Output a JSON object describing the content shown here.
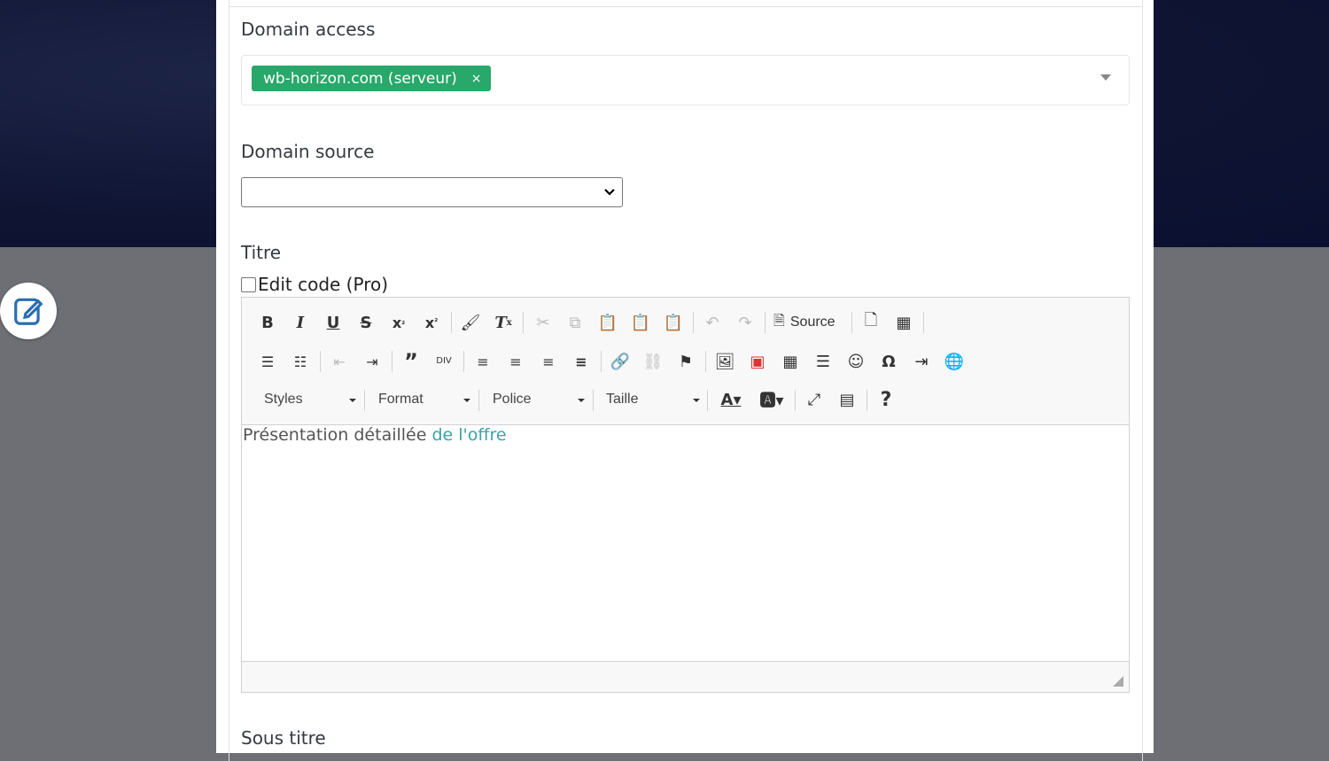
{
  "form": {
    "domain_access": {
      "label": "Domain access",
      "selected_tag": "wb-horizon.com (serveur)",
      "tag_remove": "×"
    },
    "domain_source": {
      "label": "Domain source",
      "value": ""
    },
    "titre": {
      "label": "Titre",
      "edit_code_label": "Edit code (Pro)",
      "edit_code_checked": false
    },
    "editor": {
      "toolbar_row1": [
        "bold",
        "italic",
        "underline",
        "strikethrough",
        "subscript",
        "superscript",
        "copy-formatting",
        "remove-format",
        "cut",
        "copy",
        "paste",
        "paste-text",
        "paste-word",
        "undo",
        "redo",
        "source",
        "preview",
        "templates"
      ],
      "source_label": "Source",
      "combos": {
        "styles": "Styles",
        "format": "Format",
        "police": "Police",
        "taille": "Taille"
      },
      "content_text": "Présentation détaillée ",
      "content_link": "de l'offre"
    },
    "sous_titre": {
      "label": "Sous titre"
    }
  },
  "colors": {
    "accent_green": "#28a86a",
    "link_teal": "#3aa3a8"
  }
}
